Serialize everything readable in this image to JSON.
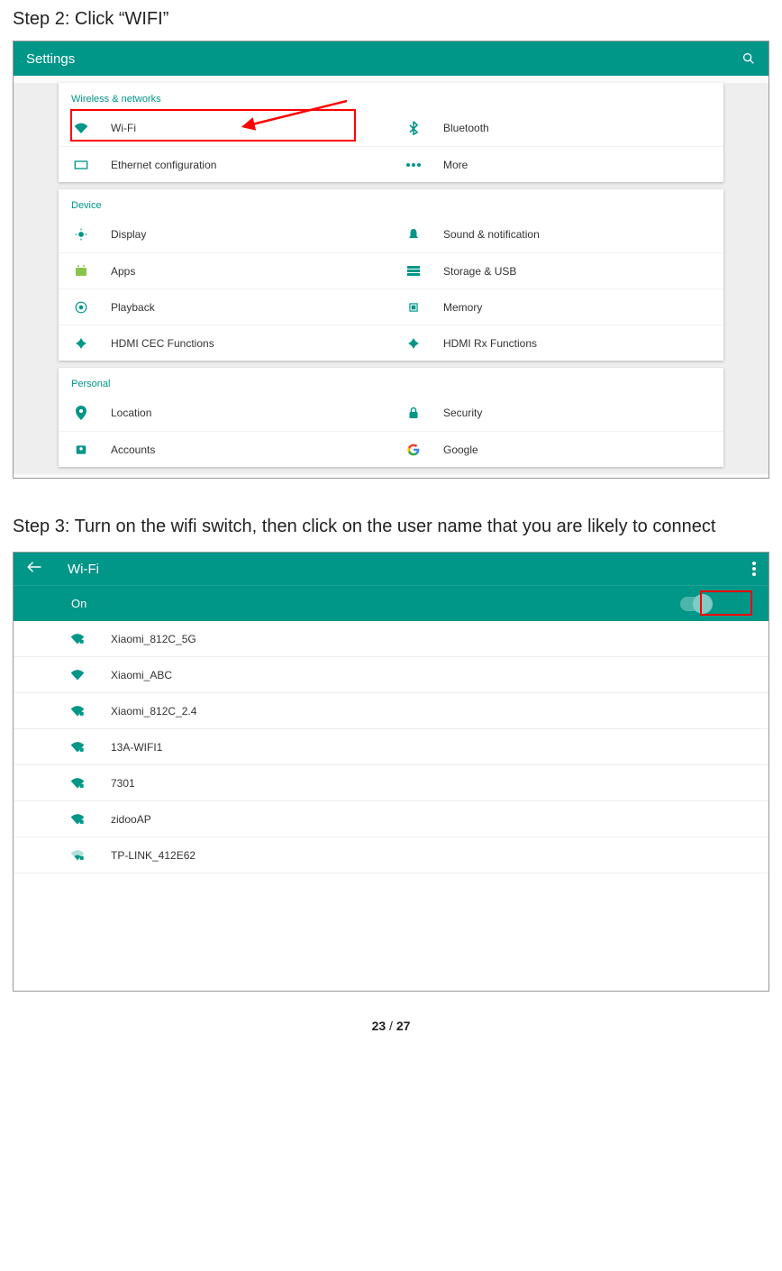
{
  "step2_title": "Step 2: Click “WIFI”",
  "step3_title": "Step 3: Turn on the wifi switch, then click on the user name that you are likely to connect",
  "settings": {
    "title": "Settings",
    "section_wireless": "Wireless & networks",
    "wifi": "Wi-Fi",
    "bluetooth": "Bluetooth",
    "ethernet": "Ethernet configuration",
    "more": "More",
    "section_device": "Device",
    "display": "Display",
    "sound": "Sound & notification",
    "apps": "Apps",
    "storage": "Storage & USB",
    "playback": "Playback",
    "memory": "Memory",
    "hdmi_cec": "HDMI CEC Functions",
    "hdmi_rx": "HDMI Rx Functions",
    "section_personal": "Personal",
    "location": "Location",
    "security": "Security",
    "accounts": "Accounts",
    "google": "Google"
  },
  "wifi": {
    "title": "Wi-Fi",
    "on_label": "On",
    "networks": [
      "Xiaomi_812C_5G",
      "Xiaomi_ABC",
      "Xiaomi_812C_2.4",
      "13A-WIFI1",
      "7301",
      "zidooAP",
      "TP-LINK_412E62"
    ]
  },
  "page": {
    "current": "23",
    "sep": " / ",
    "total": "27"
  }
}
